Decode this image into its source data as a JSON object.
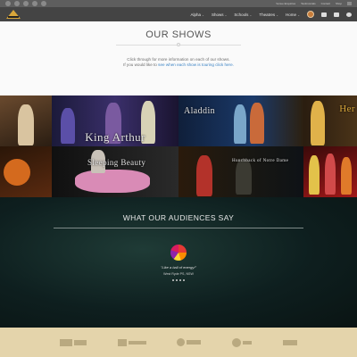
{
  "topbar": {
    "social": [
      "youtube-icon",
      "facebook-icon",
      "twitter-icon",
      "instagram-icon",
      "linkedin-icon"
    ],
    "utility": [
      "Venue Enquiries",
      "Testimonials",
      "Contact",
      "Shop"
    ]
  },
  "nav": {
    "items": [
      {
        "label": "Alpha",
        "chevron": "⌄"
      },
      {
        "label": "Shows",
        "chevron": "⌄"
      },
      {
        "label": "Schools",
        "chevron": "⌄"
      },
      {
        "label": "Theatres",
        "chevron": "⌄"
      },
      {
        "label": "Home",
        "chevron": "⌄"
      }
    ]
  },
  "shows": {
    "title": "OUR SHOWS",
    "intro_line1": "Click through for more information on each of our shows.",
    "intro_line2_prefix": "If you would like to",
    "intro_link": "see when each show is touring click here."
  },
  "gallery": {
    "tiles": [
      {
        "title": ""
      },
      {
        "title": "King Arthur"
      },
      {
        "title": "Aladdin"
      },
      {
        "title": "Her"
      },
      {
        "title": ""
      },
      {
        "title": "Sleeping Beauty"
      },
      {
        "title": "Hunchback of Notre Dame"
      },
      {
        "title": ""
      }
    ]
  },
  "audiences": {
    "title": "WHAT OUR AUDIENCES SAY",
    "quote": "\"Like a ball of energy!\"",
    "author": "West Ryde PS, NSW"
  },
  "footer": {
    "logos": [
      "Arts NSW",
      "Education Queensland",
      "Queensland Department",
      "ACT Government",
      "NSW Schools"
    ]
  }
}
